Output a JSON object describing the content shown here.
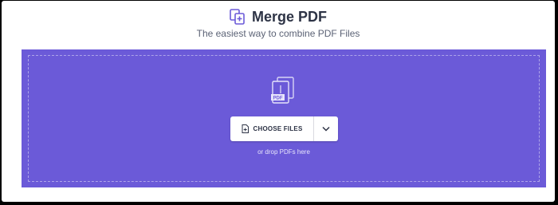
{
  "header": {
    "title": "Merge PDF",
    "subtitle": "The easiest way to combine PDF Files"
  },
  "upload": {
    "choose_label": "CHOOSE FILES",
    "drop_hint": "or drop PDFs here",
    "file_badge": "PDF"
  },
  "colors": {
    "dropzone": "#6b5ad8",
    "annotation_arrow": "#d43c3c",
    "logo": "#6b5ad8"
  },
  "icons": {
    "logo": "merge-pdf-icon",
    "files": "pdf-files-icon",
    "choose": "file-add-icon",
    "dropdown": "chevron-down-icon"
  }
}
